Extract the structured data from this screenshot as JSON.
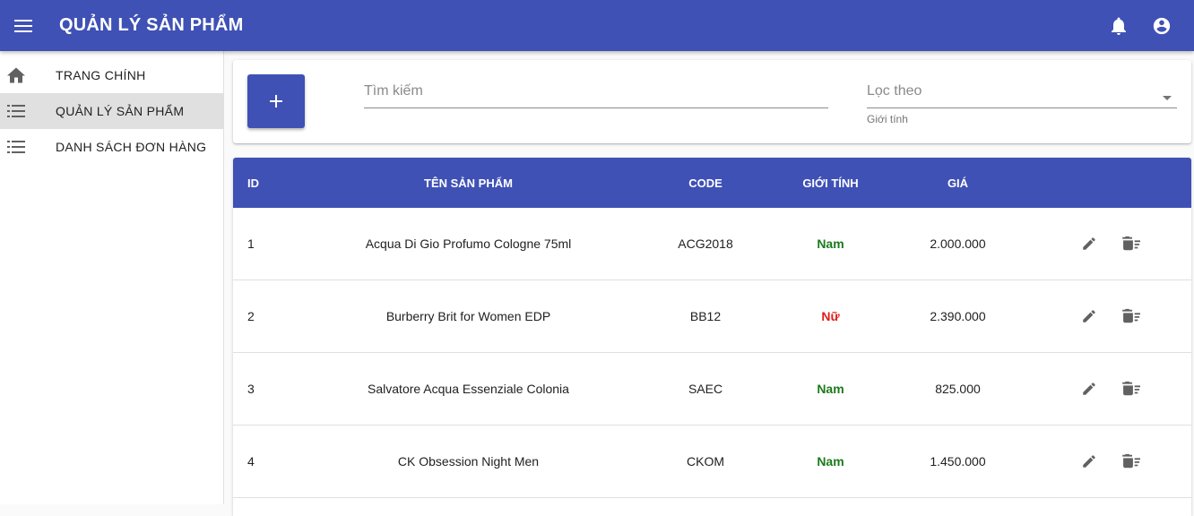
{
  "appbar": {
    "title": "QUẢN LÝ SẢN PHẨM"
  },
  "sidebar": {
    "items": [
      {
        "label": "TRANG CHÍNH",
        "icon": "home-icon",
        "active": false
      },
      {
        "label": "QUẢN LÝ SẢN PHẨM",
        "icon": "list-icon",
        "active": true
      },
      {
        "label": "DANH SÁCH ĐƠN HÀNG",
        "icon": "list-icon",
        "active": false
      }
    ]
  },
  "toolbar": {
    "add_label": "+",
    "search_placeholder": "Tìm kiếm",
    "filter_label": "Lọc theo",
    "filter_helper": "Giới tính"
  },
  "table": {
    "headers": {
      "id": "ID",
      "name": "TÊN SẢN PHẨM",
      "code": "CODE",
      "gender": "GIỚI TÍNH",
      "price": "GIÁ"
    },
    "rows": [
      {
        "id": "1",
        "name": "Acqua Di Gio Profumo Cologne 75ml",
        "code": "ACG2018",
        "gender": "Nam",
        "price": "2.000.000"
      },
      {
        "id": "2",
        "name": "Burberry Brit for Women EDP",
        "code": "BB12",
        "gender": "Nữ",
        "price": "2.390.000"
      },
      {
        "id": "3",
        "name": "Salvatore Acqua Essenziale Colonia",
        "code": "SAEC",
        "gender": "Nam",
        "price": "825.000"
      },
      {
        "id": "4",
        "name": "CK Obsession Night Men",
        "code": "CKOM",
        "gender": "Nam",
        "price": "1.450.000"
      }
    ]
  },
  "colors": {
    "primary": "#3f51b5",
    "male": "#1b7a1b",
    "female": "#e01b1b"
  }
}
